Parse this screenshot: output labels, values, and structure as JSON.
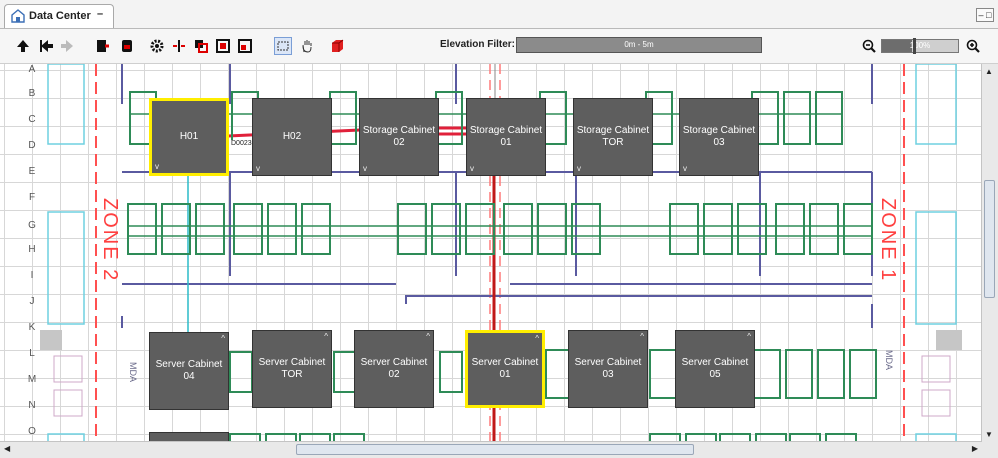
{
  "tab": {
    "title": "Data Center",
    "min_label": "–"
  },
  "window_buttons": {
    "label": "– □"
  },
  "toolbar": {
    "elevation_filter_label": "Elevation Filter:",
    "elevation_filter_value": "0m - 5m",
    "zoom_value": "100%",
    "zoom_fraction": 0.4
  },
  "row_labels": [
    "A",
    "B",
    "C",
    "D",
    "E",
    "F",
    "G",
    "H",
    "I",
    "J",
    "K",
    "L",
    "M",
    "N",
    "O"
  ],
  "zones": {
    "left": "ZONE 2",
    "right": "ZONE 1"
  },
  "mda": {
    "left": "MDA",
    "right": "MDA"
  },
  "small_tag": "D0023",
  "cabinets_top": [
    {
      "id": "h01",
      "label": "H01",
      "selected": true
    },
    {
      "id": "h02",
      "label": "H02",
      "selected": false
    },
    {
      "id": "storage-02",
      "label": "Storage Cabinet 02",
      "selected": false
    },
    {
      "id": "storage-01",
      "label": "Storage Cabinet 01",
      "selected": false
    },
    {
      "id": "storage-tor",
      "label": "Storage Cabinet TOR",
      "selected": false
    },
    {
      "id": "storage-03",
      "label": "Storage Cabinet 03",
      "selected": false
    }
  ],
  "cabinets_bottom": [
    {
      "id": "server-04",
      "label": "Server Cabinet 04",
      "selected": false
    },
    {
      "id": "server-tor",
      "label": "Server Cabinet TOR",
      "selected": false
    },
    {
      "id": "server-02",
      "label": "Server Cabinet 02",
      "selected": false
    },
    {
      "id": "server-01",
      "label": "Server Cabinet 01",
      "selected": true
    },
    {
      "id": "server-03",
      "label": "Server Cabinet 03",
      "selected": false
    },
    {
      "id": "server-05",
      "label": "Server Cabinet 05",
      "selected": false
    }
  ],
  "caret_down": "v",
  "caret_up": "^",
  "colors": {
    "accent": "#ffee00",
    "rack": "#5e5e5e",
    "zone": "#ff4040",
    "equip": "#2e8b57"
  }
}
